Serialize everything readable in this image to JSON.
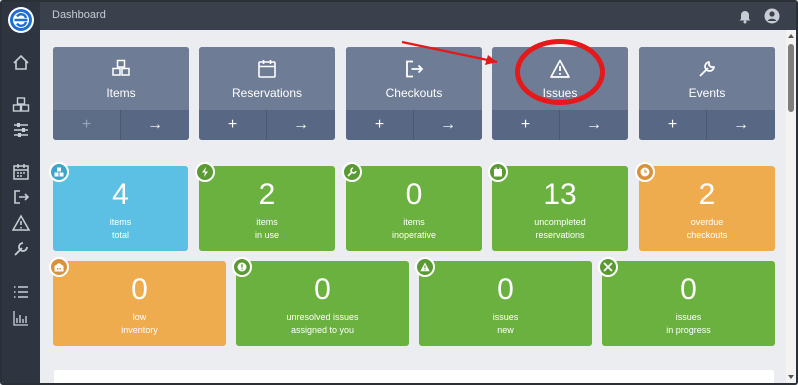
{
  "topbar": {
    "title": "Dashboard"
  },
  "nav_cards": [
    {
      "label": "Items",
      "icon": "cubes-icon",
      "left_button": "+",
      "right_button": "→",
      "left_disabled": true
    },
    {
      "label": "Reservations",
      "icon": "calendar-icon",
      "left_button": "+",
      "right_button": "→",
      "left_disabled": false
    },
    {
      "label": "Checkouts",
      "icon": "sign-out-icon",
      "left_button": "+",
      "right_button": "→",
      "left_disabled": false
    },
    {
      "label": "Issues",
      "icon": "warning-icon",
      "left_button": "+",
      "right_button": "→",
      "left_disabled": false
    },
    {
      "label": "Events",
      "icon": "wrench-icon",
      "left_button": "+",
      "right_button": "→",
      "left_disabled": false
    }
  ],
  "stats_row1": [
    {
      "value": "4",
      "line1": "items",
      "line2": "total",
      "color": "#5bc0e3"
    },
    {
      "value": "2",
      "line1": "items",
      "line2": "in use",
      "color": "#6ab13f"
    },
    {
      "value": "0",
      "line1": "items",
      "line2": "inoperative",
      "color": "#6ab13f"
    },
    {
      "value": "13",
      "line1": "uncompleted",
      "line2": "reservations",
      "color": "#6ab13f"
    },
    {
      "value": "2",
      "line1": "overdue",
      "line2": "checkouts",
      "color": "#efac4e"
    }
  ],
  "stats_row2": [
    {
      "value": "0",
      "line1": "low",
      "line2": "inventory",
      "color": "#efac4e"
    },
    {
      "value": "0",
      "line1": "unresolved issues",
      "line2": "assigned to you",
      "color": "#6ab13f"
    },
    {
      "value": "0",
      "line1": "issues",
      "line2": "new",
      "color": "#6ab13f"
    },
    {
      "value": "0",
      "line1": "issues",
      "line2": "in progress",
      "color": "#6ab13f"
    }
  ],
  "sidebar": {
    "items": [
      {
        "icon": "home-icon"
      },
      {
        "icon": "cubes-icon"
      },
      {
        "icon": "sliders-icon"
      },
      {
        "icon": "calendar-icon"
      },
      {
        "icon": "sign-out-icon"
      },
      {
        "icon": "warning-icon"
      },
      {
        "icon": "wrench-icon"
      },
      {
        "icon": "list-icon"
      },
      {
        "icon": "bar-chart-icon"
      }
    ]
  },
  "annotation": {
    "color": "#e51919"
  }
}
